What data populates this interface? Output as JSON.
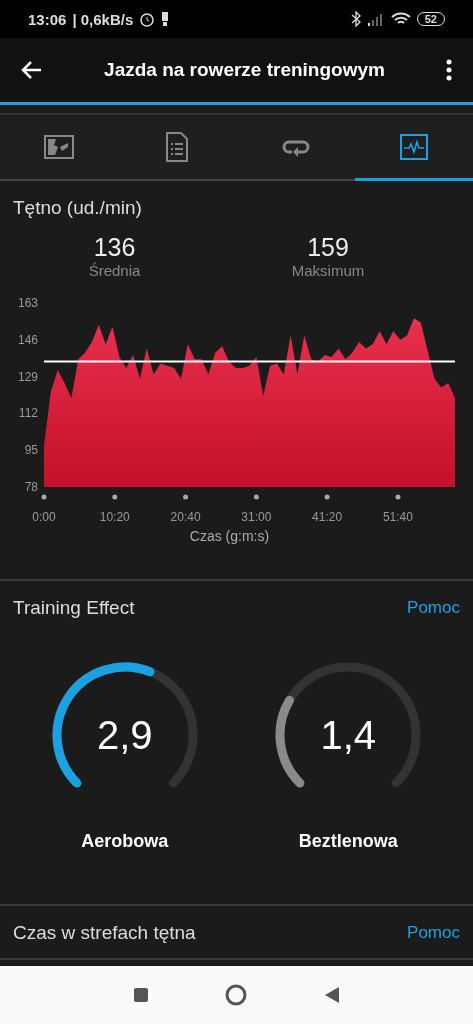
{
  "status_bar": {
    "time": "13:06",
    "speed": "| 0,6kB/s",
    "battery": "52"
  },
  "app_bar": {
    "title": "Jazda na rowerze treningowym"
  },
  "tabs": [
    {
      "kind": "map",
      "selected": false
    },
    {
      "kind": "summary",
      "selected": false
    },
    {
      "kind": "laps",
      "selected": false
    },
    {
      "kind": "charts",
      "selected": true
    }
  ],
  "heart_rate": {
    "title": "Tętno (ud./min)",
    "stats": [
      {
        "value": "136",
        "label": "Średnia"
      },
      {
        "value": "159",
        "label": "Maksimum"
      }
    ],
    "chart_data": {
      "type": "area",
      "xlabel": "Czas (g:m:s)",
      "ylim": [
        78,
        163
      ],
      "yticks": [
        78,
        95,
        112,
        129,
        146,
        163
      ],
      "xlim": [
        0,
        60
      ],
      "xticks": [
        {
          "value": 0,
          "label": "0:00"
        },
        {
          "value": 10.33,
          "label": "10:20"
        },
        {
          "value": 20.67,
          "label": "20:40"
        },
        {
          "value": 31,
          "label": "31:00"
        },
        {
          "value": 41.33,
          "label": "41:20"
        },
        {
          "value": 51.67,
          "label": "51:40"
        }
      ],
      "x": [
        0,
        1,
        2,
        3,
        4,
        5,
        6,
        7,
        8,
        9,
        10,
        11,
        12,
        13,
        14,
        15,
        16,
        17,
        18,
        19,
        20,
        21,
        22,
        23,
        24,
        25,
        26,
        27,
        28,
        29,
        30,
        31,
        32,
        33,
        34,
        35,
        36,
        37,
        38,
        39,
        40,
        41,
        42,
        43,
        44,
        45,
        46,
        47,
        48,
        49,
        50,
        51,
        52,
        53,
        54,
        55,
        56,
        57,
        58,
        59,
        60
      ],
      "series": [
        {
          "color": "#e8304f",
          "values": [
            97,
            122,
            132,
            126,
            119,
            137,
            140,
            145,
            153,
            144,
            152,
            138,
            133,
            139,
            128,
            142,
            130,
            135,
            134,
            133,
            128,
            144,
            137,
            137,
            130,
            140,
            143,
            136,
            133,
            133,
            134,
            138,
            120,
            134,
            135,
            130,
            148,
            130,
            148,
            137,
            136,
            139,
            138,
            142,
            137,
            140,
            145,
            142,
            144,
            150,
            144,
            150,
            146,
            148,
            156,
            154,
            141,
            128,
            124,
            126,
            119
          ]
        }
      ],
      "ref_lines": [
        {
          "axis": "y",
          "value": 136
        }
      ]
    }
  },
  "training_effect": {
    "title": "Training Effect",
    "help": "Pomoc",
    "gauges": [
      {
        "value": "2,9",
        "label": "Aerobowa",
        "color": "#1ba1e2"
      },
      {
        "value": "1,4",
        "label": "Beztlenowa",
        "color": "#8a8a8a"
      }
    ]
  },
  "zones": {
    "title": "Czas w strefach tętna",
    "help": "Pomoc"
  }
}
